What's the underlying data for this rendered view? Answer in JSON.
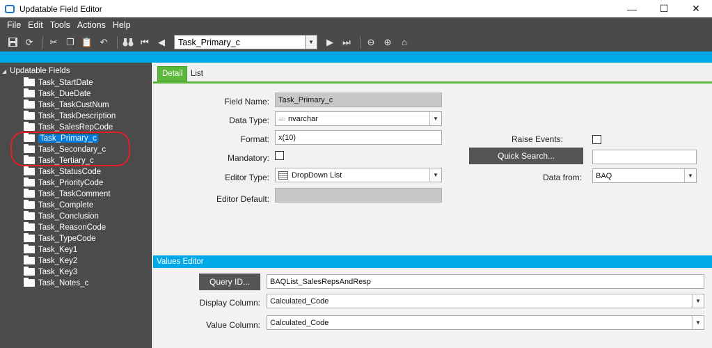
{
  "window": {
    "title": "Updatable Field Editor",
    "min": "—",
    "max": "☐",
    "close": "✕"
  },
  "menu": [
    "File",
    "Edit",
    "Tools",
    "Actions",
    "Help"
  ],
  "toolbar": {
    "nav_value": "Task_Primary_c"
  },
  "tree": {
    "root": "Updatable Fields",
    "items": [
      "Task_StartDate",
      "Task_DueDate",
      "Task_TaskCustNum",
      "Task_TaskDescription",
      "Task_SalesRepCode",
      "Task_Primary_c",
      "Task_Secondary_c",
      "Task_Tertiary_c",
      "Task_StatusCode",
      "Task_PriorityCode",
      "Task_TaskComment",
      "Task_Complete",
      "Task_Conclusion",
      "Task_ReasonCode",
      "Task_TypeCode",
      "Task_Key1",
      "Task_Key2",
      "Task_Key3",
      "Task_Notes_c"
    ],
    "selected": "Task_Primary_c"
  },
  "tabs": {
    "detail": "Detail",
    "list": "List"
  },
  "detail": {
    "field_name_label": "Field Name:",
    "field_name": "Task_Primary_c",
    "data_type_label": "Data Type:",
    "data_type_hint": "ab",
    "data_type": "nvarchar",
    "format_label": "Format:",
    "format": "x(10)",
    "mandatory_label": "Mandatory:",
    "editor_type_label": "Editor Type:",
    "editor_type": "DropDown List",
    "editor_default_label": "Editor Default:",
    "editor_default": "",
    "raise_events_label": "Raise Events:",
    "quick_search_label": "Quick Search...",
    "quick_search_value": "",
    "data_from_label": "Data from:",
    "data_from": "BAQ"
  },
  "values_editor": {
    "title": "Values Editor",
    "query_id_label": "Query ID...",
    "query_id": "BAQList_SalesRepsAndResp",
    "display_column_label": "Display Column:",
    "display_column": "Calculated_Code",
    "value_column_label": "Value Column:",
    "value_column": "Calculated_Code"
  }
}
